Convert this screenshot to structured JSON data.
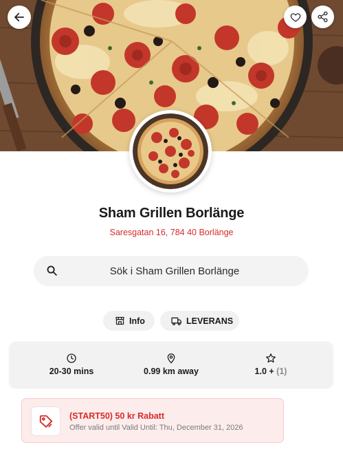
{
  "header": {
    "back_icon": "arrow-left-icon",
    "favorite_icon": "heart-icon",
    "share_icon": "share-icon"
  },
  "restaurant": {
    "name": "Sham Grillen Borlänge",
    "address": "Saresgatan 16, 784 40 Borlänge"
  },
  "search": {
    "placeholder": "Sök i Sham Grillen Borlänge"
  },
  "pills": {
    "info_label": "Info",
    "delivery_label": "LEVERANS"
  },
  "stats": {
    "time": "20-30 mins",
    "distance": "0.99 km away",
    "rating": "1.0 +",
    "rating_count": "(1)"
  },
  "offer": {
    "title": "(START50) 50 kr Rabatt",
    "subtitle": "Offer valid until Valid Until: Thu, December 31, 2026"
  },
  "colors": {
    "accent": "#d62b2b",
    "offer_bg": "#fdecec",
    "surface": "#f2f2f2"
  }
}
